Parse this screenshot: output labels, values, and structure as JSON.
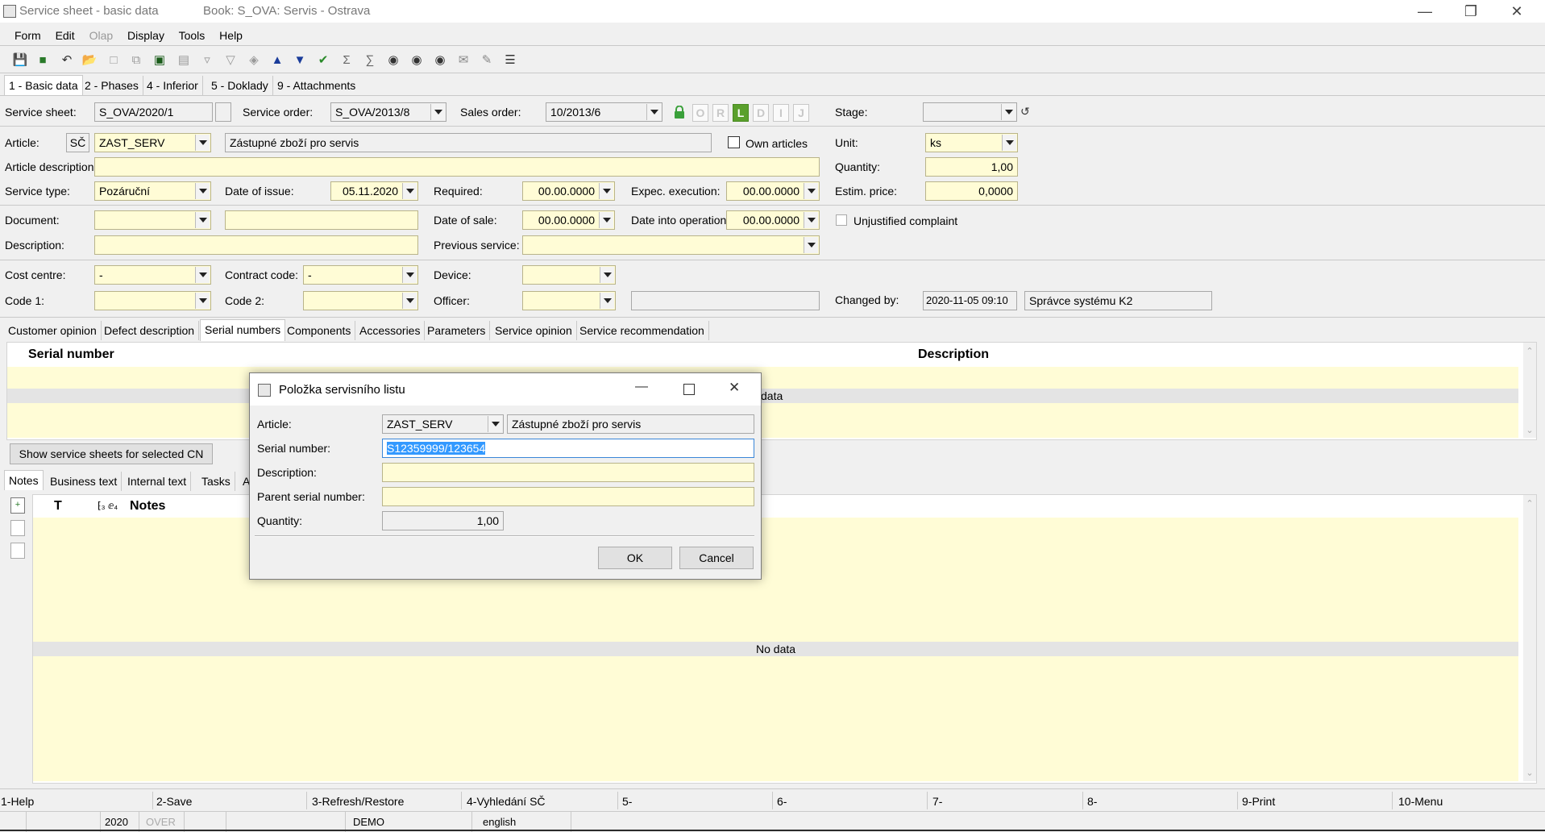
{
  "window": {
    "title": "Service sheet - basic data",
    "book": "Book: S_OVA: Servis - Ostrava"
  },
  "menu": [
    "Form",
    "Edit",
    "Olap",
    "Display",
    "Tools",
    "Help"
  ],
  "main_tabs": [
    "1 - Basic data",
    "2 - Phases",
    "4 - Inferior",
    "5 - Doklady",
    "9 - Attachments"
  ],
  "form": {
    "service_sheet_label": "Service sheet:",
    "service_sheet_value": "S_OVA/2020/1",
    "service_order_label": "Service order:",
    "service_order_value": "S_OVA/2013/8",
    "sales_order_label": "Sales order:",
    "sales_order_value": "10/2013/6",
    "status_letters": [
      "O",
      "R",
      "L",
      "D",
      "I",
      "J"
    ],
    "stage_label": "Stage:",
    "article_label": "Article:",
    "article_prefix": "SČ",
    "article_code": "ZAST_SERV",
    "article_name": "Zástupné zboží pro servis",
    "own_articles_label": "Own articles",
    "unit_label": "Unit:",
    "unit_value": "ks",
    "article_description_label": "Article description:",
    "quantity_label": "Quantity:",
    "quantity_value": "1,00",
    "service_type_label": "Service type:",
    "service_type_value": "Pozáruční",
    "date_of_issue_label": "Date of issue:",
    "date_of_issue_value": "05.11.2020",
    "required_label": "Required:",
    "required_value": "00.00.0000",
    "expec_execution_label": "Expec. execution:",
    "expec_execution_value": "00.00.0000",
    "estim_price_label": "Estim. price:",
    "estim_price_value": "0,0000",
    "document_label": "Document:",
    "date_of_sale_label": "Date of sale:",
    "date_of_sale_value": "00.00.0000",
    "date_into_operation_label": "Date into operation",
    "date_into_operation_value": "00.00.0000",
    "unjustified_complaint_label": "Unjustified complaint",
    "description_label": "Description:",
    "previous_service_label": "Previous service:",
    "cost_centre_label": "Cost centre:",
    "cost_centre_value": "-",
    "contract_code_label": "Contract code:",
    "contract_code_value": "-",
    "device_label": "Device:",
    "code1_label": "Code 1:",
    "code2_label": "Code 2:",
    "officer_label": "Officer:",
    "changed_by_label": "Changed by:",
    "changed_by_date": "2020-11-05 09:10",
    "changed_by_user": "Správce systému K2"
  },
  "sub_tabs": [
    "Customer opinion",
    "Defect description",
    "Serial numbers",
    "Components",
    "Accessories",
    "Parameters",
    "Service opinion",
    "Service recommendation"
  ],
  "serial_grid": {
    "col_serial": "Serial number",
    "col_description": "Description",
    "no_data_fragment": "data"
  },
  "show_sheets_button": "Show service sheets for selected CN",
  "notes_tabs": [
    "Notes",
    "Business text",
    "Internal text",
    "Tasks",
    "A"
  ],
  "notes_grid": {
    "col_t": "T",
    "col_notes": "Notes",
    "no_data": "No data"
  },
  "dialog": {
    "title": "Položka servisního listu",
    "article_label": "Article:",
    "article_code": "ZAST_SERV",
    "article_name": "Zástupné zboží pro servis",
    "serial_label": "Serial number:",
    "serial_value": "S12359999/123654",
    "description_label": "Description:",
    "parent_serial_label": "Parent serial number:",
    "quantity_label": "Quantity:",
    "quantity_value": "1,00",
    "ok_label": "OK",
    "cancel_label": "Cancel"
  },
  "function_keys": [
    "1-Help",
    "2-Save",
    "3-Refresh/Restore",
    "4-Vyhledání SČ",
    "5-",
    "6-",
    "7-",
    "8-",
    "9-Print",
    "10-Menu"
  ],
  "status_bar": {
    "year": "2020",
    "over": "OVER",
    "demo": "DEMO",
    "language": "english"
  },
  "colors": {
    "field_yellow": "#fffcd6",
    "status_active": "#5aa02c",
    "lock_green": "#3aa03a",
    "selection_blue": "#3399ff"
  }
}
